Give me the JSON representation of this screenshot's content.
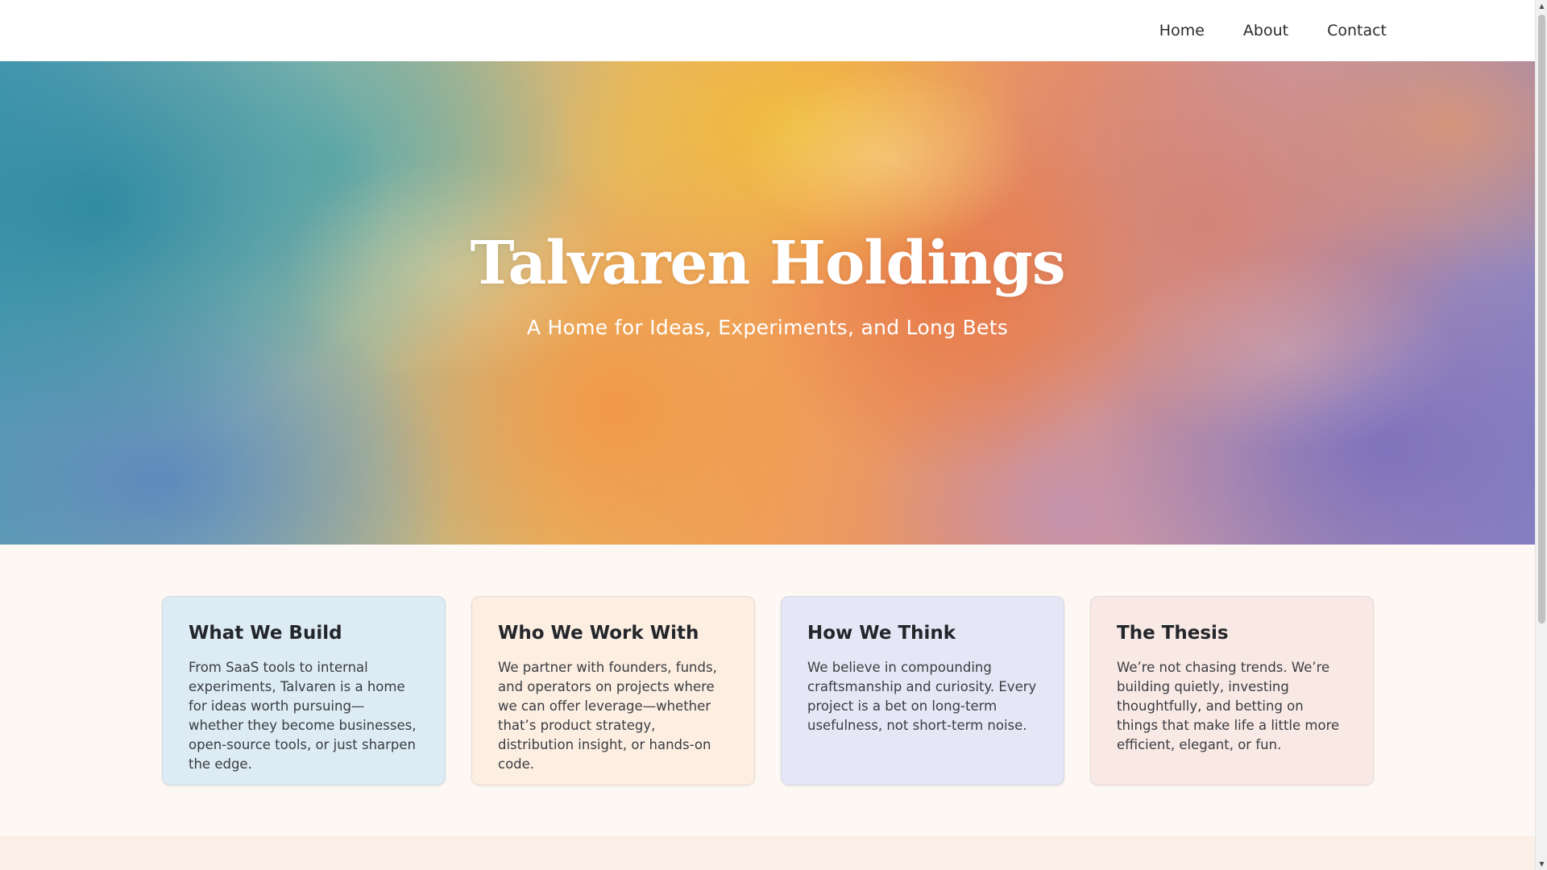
{
  "nav": {
    "links": [
      {
        "label": "Home"
      },
      {
        "label": "About"
      },
      {
        "label": "Contact"
      }
    ]
  },
  "hero": {
    "title": "Talvaren Holdings",
    "subtitle": "A Home for Ideas, Experiments, and Long Bets"
  },
  "cards": [
    {
      "title": "What We Build",
      "text": "From SaaS tools to internal experiments, Talvaren is a home for ideas worth pursuing—whether they become businesses, open-source tools, or just sharpen the edge."
    },
    {
      "title": "Who We Work With",
      "text": "We partner with founders, funds, and operators on projects where we can offer leverage—whether that’s product strategy, distribution insight, or hands-on code."
    },
    {
      "title": "How We Think",
      "text": "We believe in compounding craftsmanship and curiosity. Every project is a bet on long-term usefulness, not short-term noise."
    },
    {
      "title": "The Thesis",
      "text": "We’re not chasing trends. We’re building quietly, investing thoughtfully, and betting on things that make life a little more efficient, elegant, or fun."
    }
  ],
  "icons": {
    "scroll_up": "scroll-up-arrow-icon",
    "scroll_down": "scroll-down-arrow-icon"
  },
  "colors": {
    "card_1_bg": "#dcebf4",
    "card_2_bg": "#fdeee2",
    "card_3_bg": "#e6e7f6",
    "card_4_bg": "#f9e9e5",
    "page_bg": "#fdf8f4"
  }
}
